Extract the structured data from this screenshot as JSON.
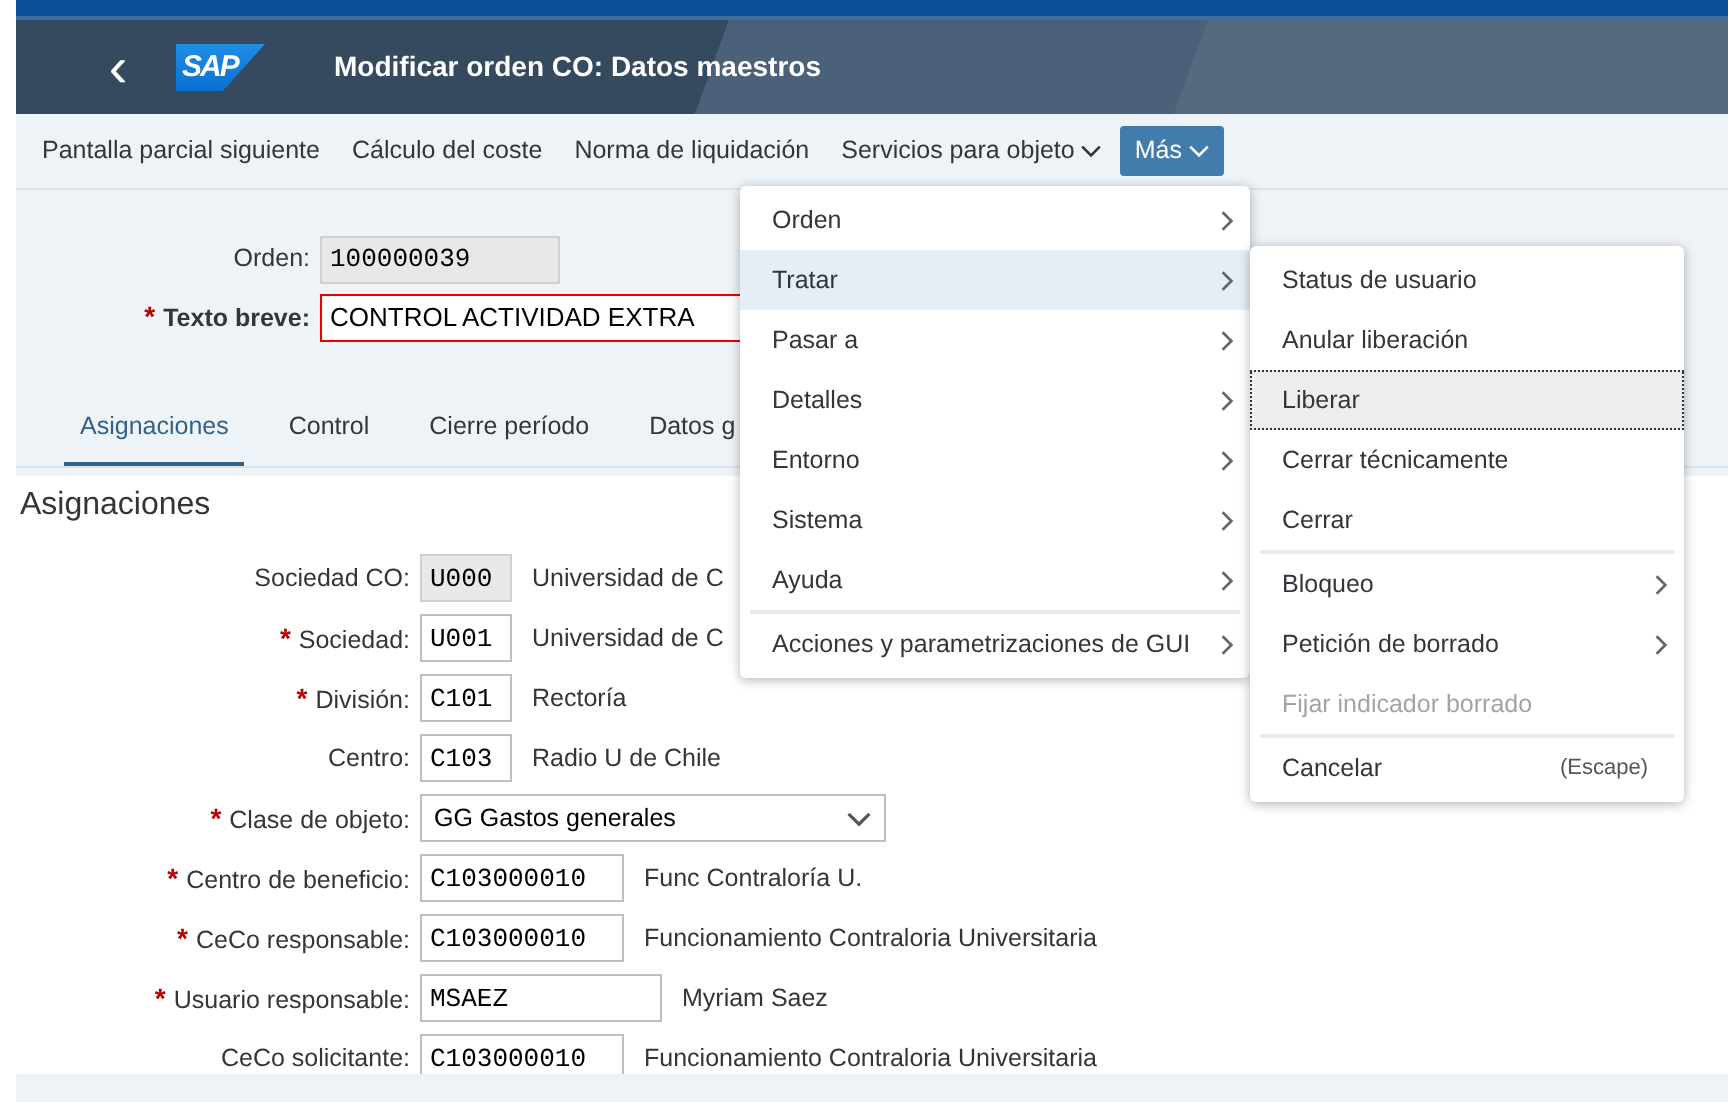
{
  "header": {
    "back": "‹",
    "logo": "SAP",
    "title": "Modificar orden CO: Datos maestros"
  },
  "required_mark": "*",
  "toolbar": [
    {
      "label": "Pantalla parcial siguiente",
      "dropdown": false,
      "selected": false
    },
    {
      "label": "Cálculo del coste",
      "dropdown": false,
      "selected": false
    },
    {
      "label": "Norma de liquidación",
      "dropdown": false,
      "selected": false
    },
    {
      "label": "Servicios para objeto",
      "dropdown": true,
      "selected": false
    },
    {
      "label": "Más",
      "dropdown": true,
      "selected": true
    }
  ],
  "header_fields": [
    {
      "label": "Orden:",
      "required": false,
      "value": "100000039",
      "readonly": true
    },
    {
      "label": "Texto breve:",
      "required": true,
      "value": "CONTROL ACTIVIDAD EXTRA",
      "readonly": false
    }
  ],
  "tabs": [
    {
      "label": "Asignaciones",
      "selected": true
    },
    {
      "label": "Control",
      "selected": false
    },
    {
      "label": "Cierre período",
      "selected": false
    },
    {
      "label": "Datos g",
      "selected": false
    }
  ],
  "section_title": "Asignaciones",
  "fields": [
    {
      "label": "Sociedad CO:",
      "required": false,
      "kind": "code",
      "readonly": true,
      "value": "U000",
      "description": "Universidad de C"
    },
    {
      "label": "Sociedad:",
      "required": true,
      "kind": "code",
      "readonly": false,
      "value": "U001",
      "description": "Universidad de C"
    },
    {
      "label": "División:",
      "required": true,
      "kind": "code",
      "readonly": false,
      "value": "C101",
      "description": "Rectoría"
    },
    {
      "label": "Centro:",
      "required": false,
      "kind": "code",
      "readonly": false,
      "value": "C103",
      "description": "Radio U de Chile"
    },
    {
      "label": "Clase de objeto:",
      "required": true,
      "kind": "select",
      "value": "GG Gastos generales"
    },
    {
      "label": "Centro de beneficio:",
      "required": true,
      "kind": "number",
      "readonly": false,
      "value": "C103000010",
      "description": "Func Contraloría U."
    },
    {
      "label": "CeCo responsable:",
      "required": true,
      "kind": "number",
      "readonly": false,
      "value": "C103000010",
      "description": "Funcionamiento Contraloria Universitaria"
    },
    {
      "label": "Usuario responsable:",
      "required": true,
      "kind": "user",
      "readonly": false,
      "value": "MSAEZ",
      "description": "Myriam Saez"
    },
    {
      "label": "CeCo solicitante:",
      "required": false,
      "kind": "number",
      "readonly": false,
      "value": "C103000010",
      "description": "Funcionamiento Contraloria Universitaria"
    }
  ],
  "menu": [
    {
      "label": "Orden",
      "submenu": true,
      "selected": false,
      "divider_before": false
    },
    {
      "label": "Tratar",
      "submenu": true,
      "selected": true,
      "divider_before": false
    },
    {
      "label": "Pasar a",
      "submenu": true,
      "selected": false,
      "divider_before": false
    },
    {
      "label": "Detalles",
      "submenu": true,
      "selected": false,
      "divider_before": false
    },
    {
      "label": "Entorno",
      "submenu": true,
      "selected": false,
      "divider_before": false
    },
    {
      "label": "Sistema",
      "submenu": true,
      "selected": false,
      "divider_before": false
    },
    {
      "label": "Ayuda",
      "submenu": true,
      "selected": false,
      "divider_before": false
    },
    {
      "label": "Acciones y parametrizaciones de GUI",
      "submenu": true,
      "selected": false,
      "divider_before": true
    }
  ],
  "submenu": [
    {
      "label": "Status de usuario",
      "submenu": false,
      "focused": false,
      "disabled": false,
      "divider_before": false
    },
    {
      "label": "Anular liberación",
      "submenu": false,
      "focused": false,
      "disabled": false,
      "divider_before": false
    },
    {
      "label": "Liberar",
      "submenu": false,
      "focused": true,
      "disabled": false,
      "divider_before": false
    },
    {
      "label": "Cerrar técnicamente",
      "submenu": false,
      "focused": false,
      "disabled": false,
      "divider_before": false
    },
    {
      "label": "Cerrar",
      "submenu": false,
      "focused": false,
      "disabled": false,
      "divider_before": false
    },
    {
      "label": "Bloqueo",
      "submenu": true,
      "focused": false,
      "disabled": false,
      "divider_before": true
    },
    {
      "label": "Petición de borrado",
      "submenu": true,
      "focused": false,
      "disabled": false,
      "divider_before": false
    },
    {
      "label": "Fijar indicador borrado",
      "submenu": false,
      "focused": false,
      "disabled": true,
      "divider_before": false
    },
    {
      "label": "Cancelar",
      "shortcut": "(Escape)",
      "submenu": false,
      "focused": false,
      "disabled": false,
      "divider_before": true
    }
  ]
}
